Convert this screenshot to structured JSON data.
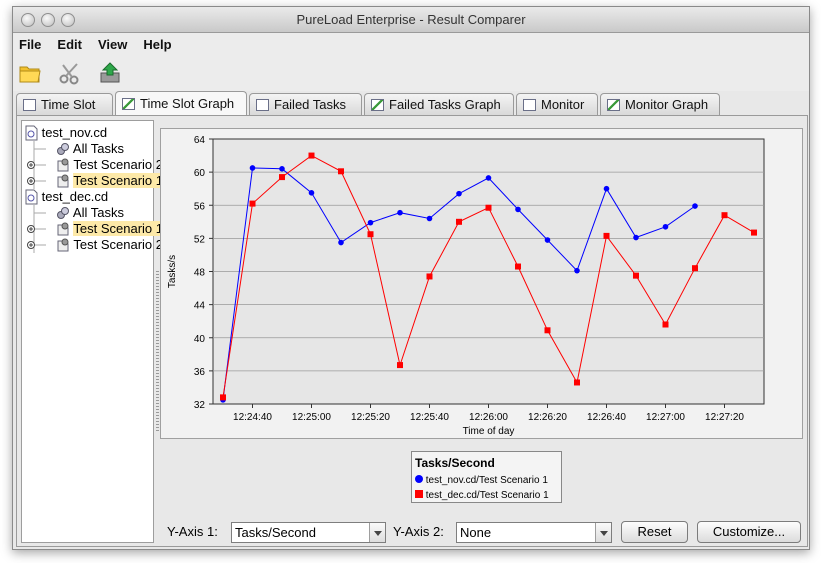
{
  "window": {
    "title": "PureLoad Enterprise - Result Comparer"
  },
  "menu": [
    "File",
    "Edit",
    "View",
    "Help"
  ],
  "toolbar": {
    "icons": [
      "folder-open-icon",
      "scissors-icon",
      "export-icon"
    ]
  },
  "tabs": [
    {
      "label": "Time Slot",
      "icon": "table-icon"
    },
    {
      "label": "Time Slot Graph",
      "icon": "graph-icon",
      "active": true
    },
    {
      "label": "Failed Tasks",
      "icon": "table-icon"
    },
    {
      "label": "Failed Tasks Graph",
      "icon": "graph-icon"
    },
    {
      "label": "Monitor",
      "icon": "table-icon"
    },
    {
      "label": "Monitor Graph",
      "icon": "graph-icon"
    }
  ],
  "tree": [
    {
      "label": "test_nov.cd",
      "level": 0,
      "icon": "document-icon"
    },
    {
      "label": "All Tasks",
      "level": 1,
      "icon": "tasks-icon"
    },
    {
      "label": "Test Scenario 2",
      "level": 1,
      "icon": "scenario-icon",
      "expandable": true
    },
    {
      "label": "Test Scenario 1",
      "level": 1,
      "icon": "scenario-icon",
      "expandable": true,
      "selected": true
    },
    {
      "label": "test_dec.cd",
      "level": 0,
      "icon": "document-icon"
    },
    {
      "label": "All Tasks",
      "level": 1,
      "icon": "tasks-icon"
    },
    {
      "label": "Test Scenario 1",
      "level": 1,
      "icon": "scenario-icon",
      "expandable": true,
      "selected": true
    },
    {
      "label": "Test Scenario 2",
      "level": 1,
      "icon": "scenario-icon",
      "expandable": true
    }
  ],
  "chart_data": {
    "type": "line",
    "xlabel": "Time of day",
    "ylabel": "Tasks/s",
    "ylim": [
      32,
      64
    ],
    "yticks": [
      32,
      36,
      40,
      44,
      48,
      52,
      56,
      60,
      64
    ],
    "xticks": [
      "12:24:40",
      "12:25:00",
      "12:25:20",
      "12:25:40",
      "12:26:00",
      "12:26:20",
      "12:26:40",
      "12:27:00",
      "12:27:20"
    ],
    "xlim": [
      "12:24:30",
      "12:27:30"
    ],
    "grid": true,
    "legend_title": "Tasks/Second",
    "series": [
      {
        "name": "test_nov.cd/Test Scenario 1",
        "color": "#0000ff",
        "marker": "circle",
        "x": [
          "12:24:30",
          "12:24:40",
          "12:24:50",
          "12:25:00",
          "12:25:10",
          "12:25:20",
          "12:25:30",
          "12:25:40",
          "12:25:50",
          "12:26:00",
          "12:26:10",
          "12:26:20",
          "12:26:30",
          "12:26:40",
          "12:26:50",
          "12:27:00",
          "12:27:10"
        ],
        "values": [
          32.5,
          60.5,
          60.4,
          57.5,
          51.5,
          53.9,
          55.1,
          54.4,
          57.4,
          59.3,
          55.5,
          51.8,
          48.1,
          58.0,
          52.1,
          53.4,
          55.9
        ]
      },
      {
        "name": "test_dec.cd/Test Scenario 1",
        "color": "#ff0000",
        "marker": "square",
        "x": [
          "12:24:30",
          "12:24:40",
          "12:24:50",
          "12:25:00",
          "12:25:10",
          "12:25:20",
          "12:25:30",
          "12:25:40",
          "12:25:50",
          "12:26:00",
          "12:26:10",
          "12:26:20",
          "12:26:30",
          "12:26:40",
          "12:26:50",
          "12:27:00",
          "12:27:10",
          "12:27:20",
          "12:27:30"
        ],
        "values": [
          32.8,
          56.2,
          59.4,
          62.0,
          60.1,
          52.5,
          36.7,
          47.4,
          54.0,
          55.7,
          48.6,
          40.9,
          34.6,
          52.3,
          47.5,
          41.6,
          48.4,
          54.8,
          52.7
        ]
      }
    ]
  },
  "controls": {
    "y1_label": "Y-Axis 1:",
    "y1_value": "Tasks/Second",
    "y2_label": "Y-Axis 2:",
    "y2_value": "None",
    "reset": "Reset",
    "customize": "Customize..."
  }
}
